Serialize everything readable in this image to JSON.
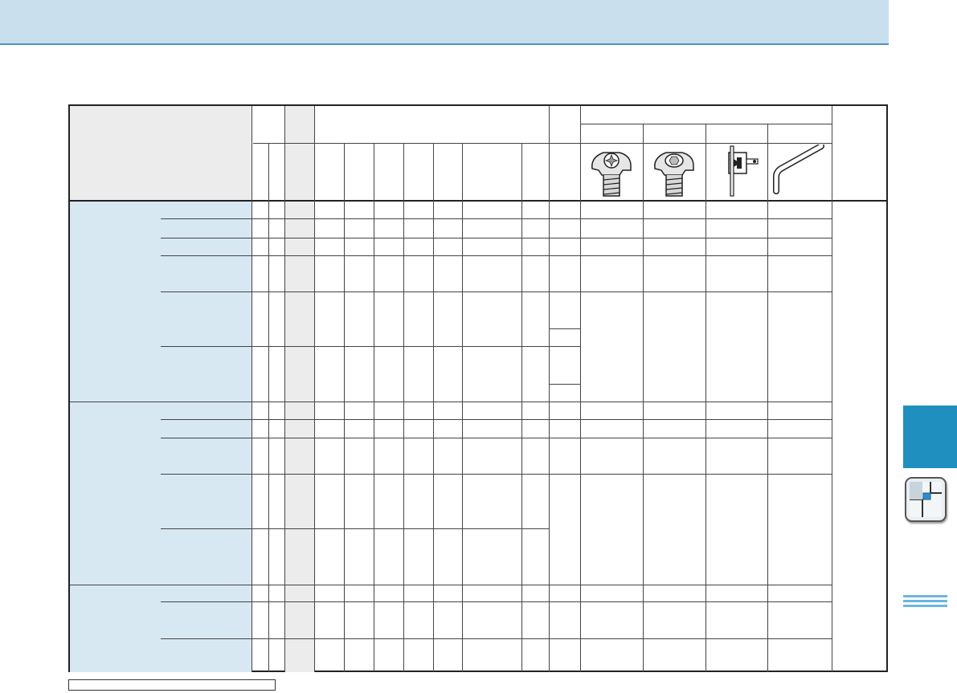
{
  "header": {
    "title": ""
  },
  "table": {
    "groups": [
      {
        "label": ""
      },
      {
        "label": ""
      },
      {
        "label": ""
      }
    ],
    "tool_icons": [
      "torx-key-icon",
      "hex-socket-key-icon",
      "flag-torx-driver-icon",
      "hex-allen-wrench-icon"
    ]
  },
  "footnote": {
    "text": ""
  },
  "side_tab": {
    "icon": "section-insert-icon",
    "color_tab": "#1f8fc0",
    "accent": "#6db6dc"
  },
  "colors": {
    "header_band": "#c9dfee",
    "header_rule": "#4a94c6",
    "group_fill": "#d8e8f3",
    "grey_column": "#ececec"
  }
}
